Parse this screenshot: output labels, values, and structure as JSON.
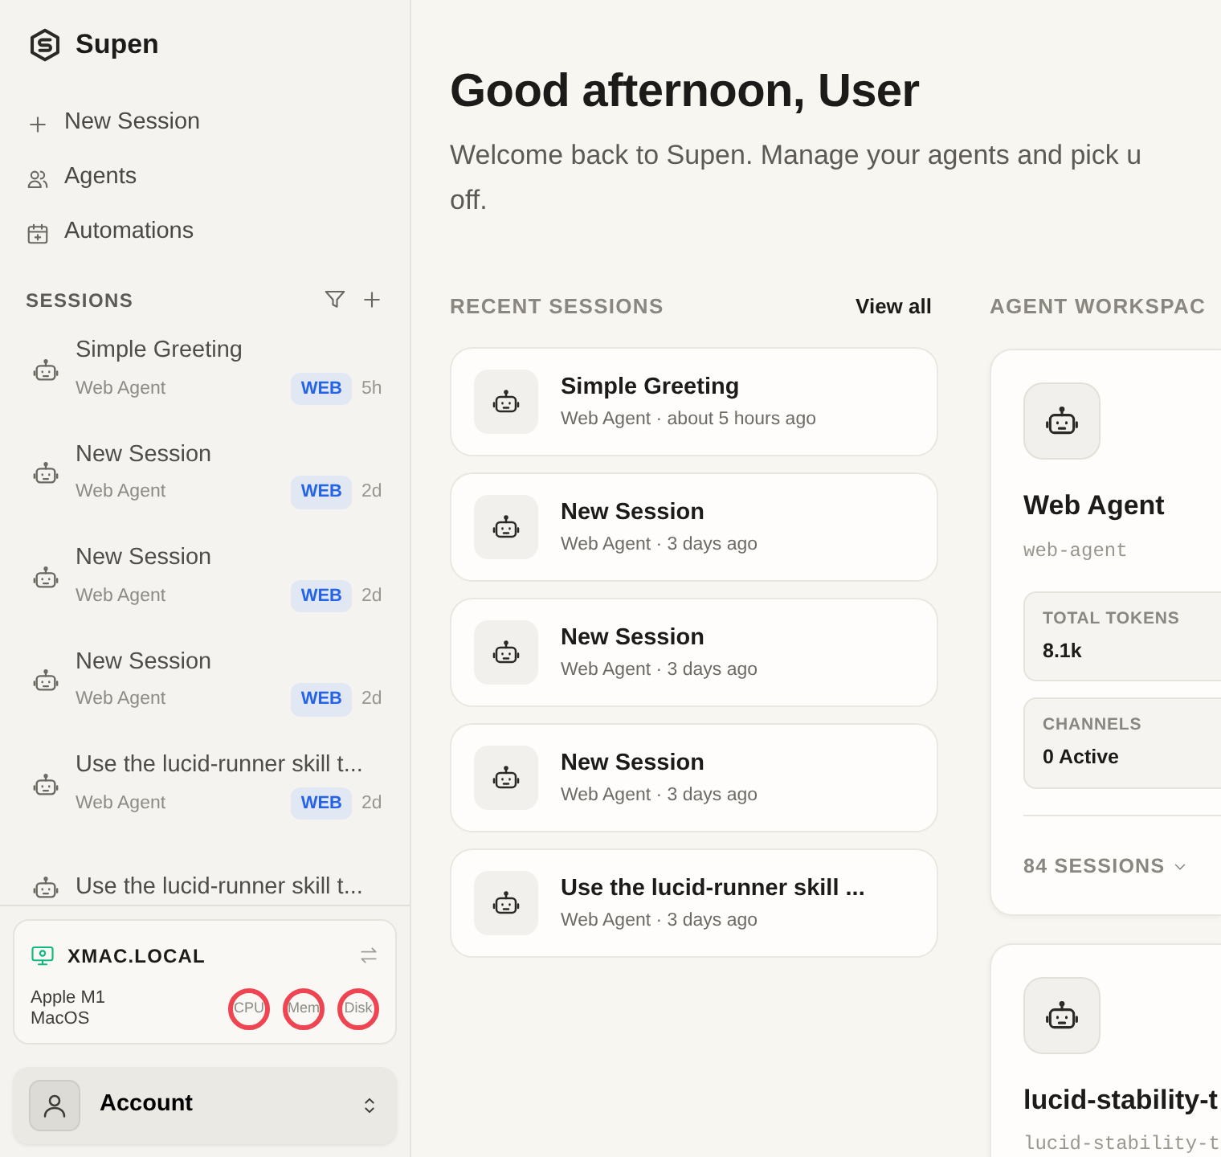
{
  "sidebar": {
    "brand": "Supen",
    "nav": [
      {
        "kind": "plus",
        "label": "New Session"
      },
      {
        "kind": "people",
        "label": "Agents"
      },
      {
        "kind": "calendar",
        "label": "Automations"
      }
    ],
    "sessions_heading": "SESSIONS",
    "sessions": [
      {
        "title": "Simple Greeting",
        "agent": "Web Agent",
        "badge": "WEB",
        "time": "5h"
      },
      {
        "title": "New Session",
        "agent": "Web Agent",
        "badge": "WEB",
        "time": "2d"
      },
      {
        "title": "New Session",
        "agent": "Web Agent",
        "badge": "WEB",
        "time": "2d"
      },
      {
        "title": "New Session",
        "agent": "Web Agent",
        "badge": "WEB",
        "time": "2d"
      },
      {
        "title": "Use the lucid-runner skill t...",
        "agent": "Web Agent",
        "badge": "WEB",
        "time": "2d"
      },
      {
        "title": "Use the lucid-runner skill t..."
      }
    ],
    "machine": {
      "host": "XMAC.LOCAL",
      "chip": "Apple M1",
      "os": "MacOS",
      "gauges": [
        {
          "label": "CPU",
          "color": "#ef4452"
        },
        {
          "label": "Mem",
          "color": "#ef4452"
        },
        {
          "label": "Disk",
          "color": "#ef4452"
        }
      ]
    },
    "account": "Account"
  },
  "main": {
    "greeting": "Good afternoon, User",
    "subtitle_lines": [
      "Welcome back to Supen. Manage your agents and pick u",
      "off."
    ],
    "recent_heading": "RECENT SESSIONS",
    "view_all": "View all",
    "separator": "·",
    "recent": [
      {
        "title": "Simple Greeting",
        "agent": "Web Agent",
        "when": "about 5 hours ago"
      },
      {
        "title": "New Session",
        "agent": "Web Agent",
        "when": "3 days ago"
      },
      {
        "title": "New Session",
        "agent": "Web Agent",
        "when": "3 days ago"
      },
      {
        "title": "New Session",
        "agent": "Web Agent",
        "when": "3 days ago"
      },
      {
        "title": "Use the lucid-runner skill ...",
        "agent": "Web Agent",
        "when": "3 days ago"
      }
    ],
    "workspace_heading": "AGENT WORKSPAC",
    "agents": [
      {
        "name": "Web Agent",
        "slug": "web-agent",
        "stats": [
          {
            "label": "TOTAL TOKENS",
            "value": "8.1k"
          },
          {
            "label": "CHANNELS",
            "value": "0 Active"
          }
        ],
        "sessions": "84 SESSIONS"
      },
      {
        "name": "lucid-stability-t",
        "slug": "lucid-stability-t"
      }
    ]
  }
}
